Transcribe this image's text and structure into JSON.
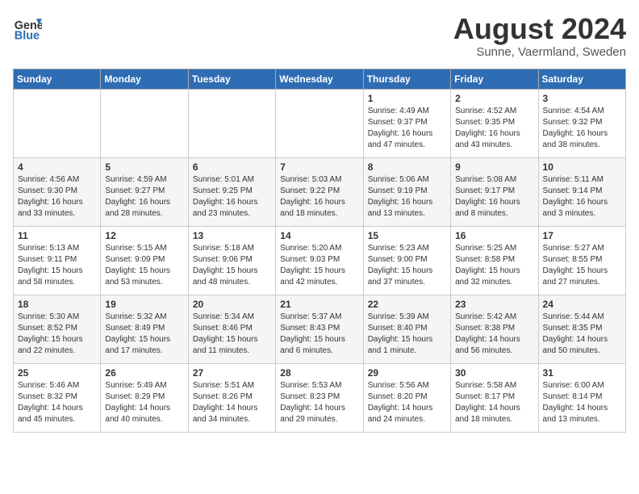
{
  "header": {
    "logo_general": "General",
    "logo_blue": "Blue",
    "month_title": "August 2024",
    "location": "Sunne, Vaermland, Sweden"
  },
  "days_of_week": [
    "Sunday",
    "Monday",
    "Tuesday",
    "Wednesday",
    "Thursday",
    "Friday",
    "Saturday"
  ],
  "weeks": [
    [
      {
        "day": "",
        "info": ""
      },
      {
        "day": "",
        "info": ""
      },
      {
        "day": "",
        "info": ""
      },
      {
        "day": "",
        "info": ""
      },
      {
        "day": "1",
        "info": "Sunrise: 4:49 AM\nSunset: 9:37 PM\nDaylight: 16 hours\nand 47 minutes."
      },
      {
        "day": "2",
        "info": "Sunrise: 4:52 AM\nSunset: 9:35 PM\nDaylight: 16 hours\nand 43 minutes."
      },
      {
        "day": "3",
        "info": "Sunrise: 4:54 AM\nSunset: 9:32 PM\nDaylight: 16 hours\nand 38 minutes."
      }
    ],
    [
      {
        "day": "4",
        "info": "Sunrise: 4:56 AM\nSunset: 9:30 PM\nDaylight: 16 hours\nand 33 minutes."
      },
      {
        "day": "5",
        "info": "Sunrise: 4:59 AM\nSunset: 9:27 PM\nDaylight: 16 hours\nand 28 minutes."
      },
      {
        "day": "6",
        "info": "Sunrise: 5:01 AM\nSunset: 9:25 PM\nDaylight: 16 hours\nand 23 minutes."
      },
      {
        "day": "7",
        "info": "Sunrise: 5:03 AM\nSunset: 9:22 PM\nDaylight: 16 hours\nand 18 minutes."
      },
      {
        "day": "8",
        "info": "Sunrise: 5:06 AM\nSunset: 9:19 PM\nDaylight: 16 hours\nand 13 minutes."
      },
      {
        "day": "9",
        "info": "Sunrise: 5:08 AM\nSunset: 9:17 PM\nDaylight: 16 hours\nand 8 minutes."
      },
      {
        "day": "10",
        "info": "Sunrise: 5:11 AM\nSunset: 9:14 PM\nDaylight: 16 hours\nand 3 minutes."
      }
    ],
    [
      {
        "day": "11",
        "info": "Sunrise: 5:13 AM\nSunset: 9:11 PM\nDaylight: 15 hours\nand 58 minutes."
      },
      {
        "day": "12",
        "info": "Sunrise: 5:15 AM\nSunset: 9:09 PM\nDaylight: 15 hours\nand 53 minutes."
      },
      {
        "day": "13",
        "info": "Sunrise: 5:18 AM\nSunset: 9:06 PM\nDaylight: 15 hours\nand 48 minutes."
      },
      {
        "day": "14",
        "info": "Sunrise: 5:20 AM\nSunset: 9:03 PM\nDaylight: 15 hours\nand 42 minutes."
      },
      {
        "day": "15",
        "info": "Sunrise: 5:23 AM\nSunset: 9:00 PM\nDaylight: 15 hours\nand 37 minutes."
      },
      {
        "day": "16",
        "info": "Sunrise: 5:25 AM\nSunset: 8:58 PM\nDaylight: 15 hours\nand 32 minutes."
      },
      {
        "day": "17",
        "info": "Sunrise: 5:27 AM\nSunset: 8:55 PM\nDaylight: 15 hours\nand 27 minutes."
      }
    ],
    [
      {
        "day": "18",
        "info": "Sunrise: 5:30 AM\nSunset: 8:52 PM\nDaylight: 15 hours\nand 22 minutes."
      },
      {
        "day": "19",
        "info": "Sunrise: 5:32 AM\nSunset: 8:49 PM\nDaylight: 15 hours\nand 17 minutes."
      },
      {
        "day": "20",
        "info": "Sunrise: 5:34 AM\nSunset: 8:46 PM\nDaylight: 15 hours\nand 11 minutes."
      },
      {
        "day": "21",
        "info": "Sunrise: 5:37 AM\nSunset: 8:43 PM\nDaylight: 15 hours\nand 6 minutes."
      },
      {
        "day": "22",
        "info": "Sunrise: 5:39 AM\nSunset: 8:40 PM\nDaylight: 15 hours\nand 1 minute."
      },
      {
        "day": "23",
        "info": "Sunrise: 5:42 AM\nSunset: 8:38 PM\nDaylight: 14 hours\nand 56 minutes."
      },
      {
        "day": "24",
        "info": "Sunrise: 5:44 AM\nSunset: 8:35 PM\nDaylight: 14 hours\nand 50 minutes."
      }
    ],
    [
      {
        "day": "25",
        "info": "Sunrise: 5:46 AM\nSunset: 8:32 PM\nDaylight: 14 hours\nand 45 minutes."
      },
      {
        "day": "26",
        "info": "Sunrise: 5:49 AM\nSunset: 8:29 PM\nDaylight: 14 hours\nand 40 minutes."
      },
      {
        "day": "27",
        "info": "Sunrise: 5:51 AM\nSunset: 8:26 PM\nDaylight: 14 hours\nand 34 minutes."
      },
      {
        "day": "28",
        "info": "Sunrise: 5:53 AM\nSunset: 8:23 PM\nDaylight: 14 hours\nand 29 minutes."
      },
      {
        "day": "29",
        "info": "Sunrise: 5:56 AM\nSunset: 8:20 PM\nDaylight: 14 hours\nand 24 minutes."
      },
      {
        "day": "30",
        "info": "Sunrise: 5:58 AM\nSunset: 8:17 PM\nDaylight: 14 hours\nand 18 minutes."
      },
      {
        "day": "31",
        "info": "Sunrise: 6:00 AM\nSunset: 8:14 PM\nDaylight: 14 hours\nand 13 minutes."
      }
    ]
  ]
}
